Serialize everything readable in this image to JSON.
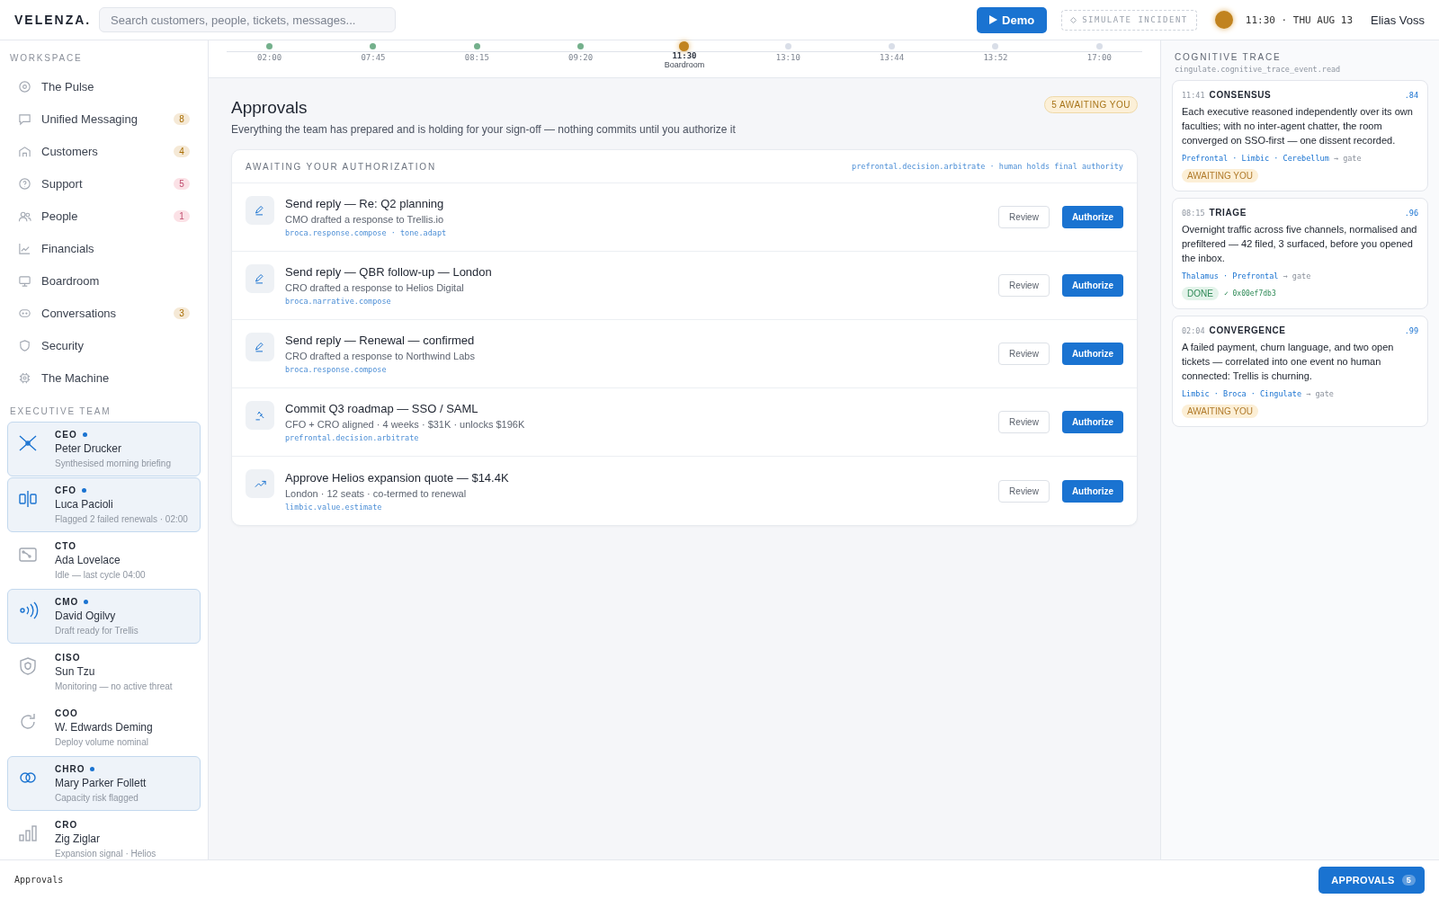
{
  "header": {
    "logo": "VELENZA.",
    "search": {
      "placeholder": "Search customers, people, tickets, messages..."
    },
    "demo_button": "Demo",
    "incident_button": "SIMULATE INCIDENT",
    "clock": "11:30 · THU AUG 13",
    "user": "Elias Voss"
  },
  "timeline": [
    {
      "time": "02:00",
      "kind": "done"
    },
    {
      "time": "07:45",
      "kind": "done"
    },
    {
      "time": "08:15",
      "kind": "done"
    },
    {
      "time": "09:20",
      "kind": "done"
    },
    {
      "time": "11:30",
      "kind": "current",
      "label": "Boardroom"
    },
    {
      "time": "13:10",
      "kind": "upcoming"
    },
    {
      "time": "13:44",
      "kind": "upcoming"
    },
    {
      "time": "13:52",
      "kind": "upcoming"
    },
    {
      "time": "17:00",
      "kind": "upcoming"
    }
  ],
  "sidebar": {
    "workspace_heading": "WORKSPACE",
    "items": [
      {
        "label": "The Pulse"
      },
      {
        "label": "Unified Messaging",
        "badge": "8",
        "color": "#f5e9d6"
      },
      {
        "label": "Customers",
        "badge": "4",
        "color": "#f5e9d6"
      },
      {
        "label": "Support",
        "badge": "5",
        "color": "#fbe1e6"
      },
      {
        "label": "People",
        "badge": "1",
        "color": "#fbe1e6"
      },
      {
        "label": "Financials"
      },
      {
        "label": "Boardroom"
      },
      {
        "label": "Conversations",
        "badge": "3",
        "color": "#f5e9d6"
      },
      {
        "label": "Security"
      },
      {
        "label": "The Machine"
      }
    ],
    "team_heading": "EXECUTIVE TEAM",
    "team": [
      {
        "role": "CEO",
        "name": "Peter Drucker",
        "status": "Synthesised morning briefing",
        "active": true
      },
      {
        "role": "CFO",
        "name": "Luca Pacioli",
        "status": "Flagged 2 failed renewals · 02:00",
        "active": true
      },
      {
        "role": "CTO",
        "name": "Ada Lovelace",
        "status": "Idle — last cycle 04:00",
        "active": false
      },
      {
        "role": "CMO",
        "name": "David Ogilvy",
        "status": "Draft ready for Trellis",
        "active": true
      },
      {
        "role": "CISO",
        "name": "Sun Tzu",
        "status": "Monitoring — no active threat",
        "active": false
      },
      {
        "role": "COO",
        "name": "W. Edwards Deming",
        "status": "Deploy volume nominal",
        "active": false
      },
      {
        "role": "CHRO",
        "name": "Mary Parker Follett",
        "status": "Capacity risk flagged",
        "active": true
      },
      {
        "role": "CRO",
        "name": "Zig Ziglar",
        "status": "Expansion signal · Helios",
        "active": false
      }
    ]
  },
  "page": {
    "title": "Approvals",
    "subtitle": "Everything the team has prepared and is holding for your sign-off — nothing commits until you authorize it",
    "badge": "5 AWAITING YOU"
  },
  "queue": {
    "heading": "AWAITING YOUR AUTHORIZATION",
    "hint": "prefrontal.decision.arbitrate · human holds final authority",
    "items": [
      {
        "kind": "reply",
        "title": "Send reply — Re: Q2 planning",
        "detail": "CMO drafted a response to Trellis.io",
        "tags": "broca.response.compose · tone.adapt",
        "review": "Review",
        "authorize": "Authorize"
      },
      {
        "kind": "reply",
        "title": "Send reply — QBR follow-up — London",
        "detail": "CRO drafted a response to Helios Digital",
        "tags": "broca.narrative.compose",
        "review": "Review",
        "authorize": "Authorize"
      },
      {
        "kind": "reply",
        "title": "Send reply — Renewal — confirmed",
        "detail": "CRO drafted a response to Northwind Labs",
        "tags": "broca.response.compose",
        "review": "Review",
        "authorize": "Authorize"
      },
      {
        "kind": "decision",
        "title": "Commit Q3 roadmap — SSO / SAML",
        "detail": "CFO + CRO aligned · 4 weeks · $31K · unlocks $196K",
        "tags": "prefrontal.decision.arbitrate",
        "review": "Review",
        "authorize": "Authorize"
      },
      {
        "kind": "quote",
        "title": "Approve Helios expansion quote — $14.4K",
        "detail": "London · 12 seats · co-termed to renewal",
        "tags": "limbic.value.estimate",
        "review": "Review",
        "authorize": "Authorize"
      }
    ]
  },
  "trace": {
    "heading": "COGNITIVE TRACE",
    "source": "cingulate.cognitive_trace_event.read",
    "events": [
      {
        "time": "11:41",
        "title": "CONSENSUS",
        "score": ".84",
        "body": "Each executive reasoned independently over its own faculties; with no inter-agent chatter, the room converged on SSO-first — one dissent recorded.",
        "modules": "Prefrontal · Limbic · Cerebellum",
        "target": "→ gate",
        "status": {
          "label": "AWAITING YOU",
          "kind": "awaiting"
        }
      },
      {
        "time": "08:15",
        "title": "TRIAGE",
        "score": ".96",
        "body": "Overnight traffic across five channels, normalised and prefiltered — 42 filed, 3 surfaced, before you opened the inbox.",
        "modules": "Thalamus · Prefrontal",
        "target": "→ gate",
        "status": {
          "label": "DONE",
          "kind": "done"
        },
        "hash": "✓ 0x00ef7db3"
      },
      {
        "time": "02:04",
        "title": "CONVERGENCE",
        "score": ".99",
        "body": "A failed payment, churn language, and two open tickets — correlated into one event no human connected: Trellis is churning.",
        "modules": "Limbic · Broca · Cingulate",
        "target": "→ gate",
        "status": {
          "label": "AWAITING YOU",
          "kind": "awaiting"
        }
      }
    ]
  },
  "footer": {
    "label": "Approvals",
    "button": "APPROVALS",
    "count": "5"
  }
}
